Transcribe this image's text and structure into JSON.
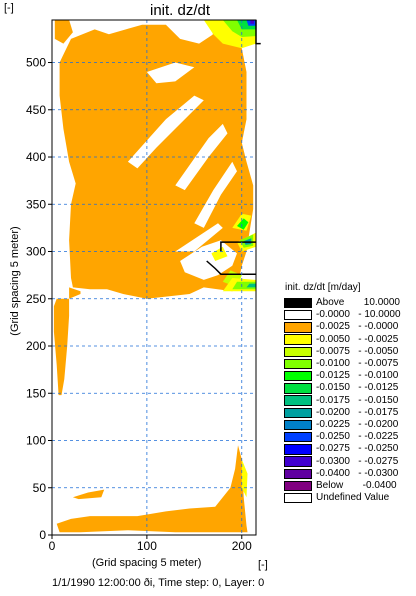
{
  "window": {
    "title": "init. dz/dt",
    "y_unit": "[-]",
    "x_unit": "[-]",
    "footer": "1/1/1990 12:00:00 ði, Time step: 0, Layer: 0"
  },
  "chart_data": {
    "type": "heatmap",
    "title": "init. dz/dt",
    "xlabel": "(Grid spacing 5 meter)",
    "ylabel": "(Grid spacing 5 meter)",
    "xlim": [
      0,
      215
    ],
    "ylim": [
      0,
      545
    ],
    "x_ticks": [
      0,
      100,
      200
    ],
    "y_ticks": [
      0,
      50,
      100,
      150,
      200,
      250,
      300,
      350,
      400,
      450,
      500
    ],
    "grid": true,
    "legend_title": "init. dz/dt [m/day]",
    "legend_position": "right",
    "classes": [
      {
        "label": "Above",
        "range": "10.0000",
        "color": "#000000"
      },
      {
        "label": "-0.0000",
        "range": "10.0000",
        "color": "#ffffff"
      },
      {
        "label": "-0.0025",
        "range": "-0.0000",
        "color": "#ffa500"
      },
      {
        "label": "-0.0050",
        "range": "-0.0025",
        "color": "#ffff00"
      },
      {
        "label": "-0.0075",
        "range": "-0.0050",
        "color": "#c8ff00"
      },
      {
        "label": "-0.0100",
        "range": "-0.0075",
        "color": "#80ff00"
      },
      {
        "label": "-0.0125",
        "range": "-0.0100",
        "color": "#00ff00"
      },
      {
        "label": "-0.0150",
        "range": "-0.0125",
        "color": "#00e040"
      },
      {
        "label": "-0.0175",
        "range": "-0.0150",
        "color": "#00c080"
      },
      {
        "label": "-0.0200",
        "range": "-0.0175",
        "color": "#00a0a0"
      },
      {
        "label": "-0.0225",
        "range": "-0.0200",
        "color": "#0080c8"
      },
      {
        "label": "-0.0250",
        "range": "-0.0225",
        "color": "#0040ff"
      },
      {
        "label": "-0.0275",
        "range": "-0.0250",
        "color": "#0000ff"
      },
      {
        "label": "-0.0300",
        "range": "-0.0275",
        "color": "#4000d0"
      },
      {
        "label": "-0.0400",
        "range": "-0.0300",
        "color": "#6000a0"
      },
      {
        "label": "Below",
        "range": "-0.0400",
        "color": "#800080"
      },
      {
        "label": "Undefined Value",
        "range": "",
        "color": "#ffffff"
      }
    ]
  }
}
